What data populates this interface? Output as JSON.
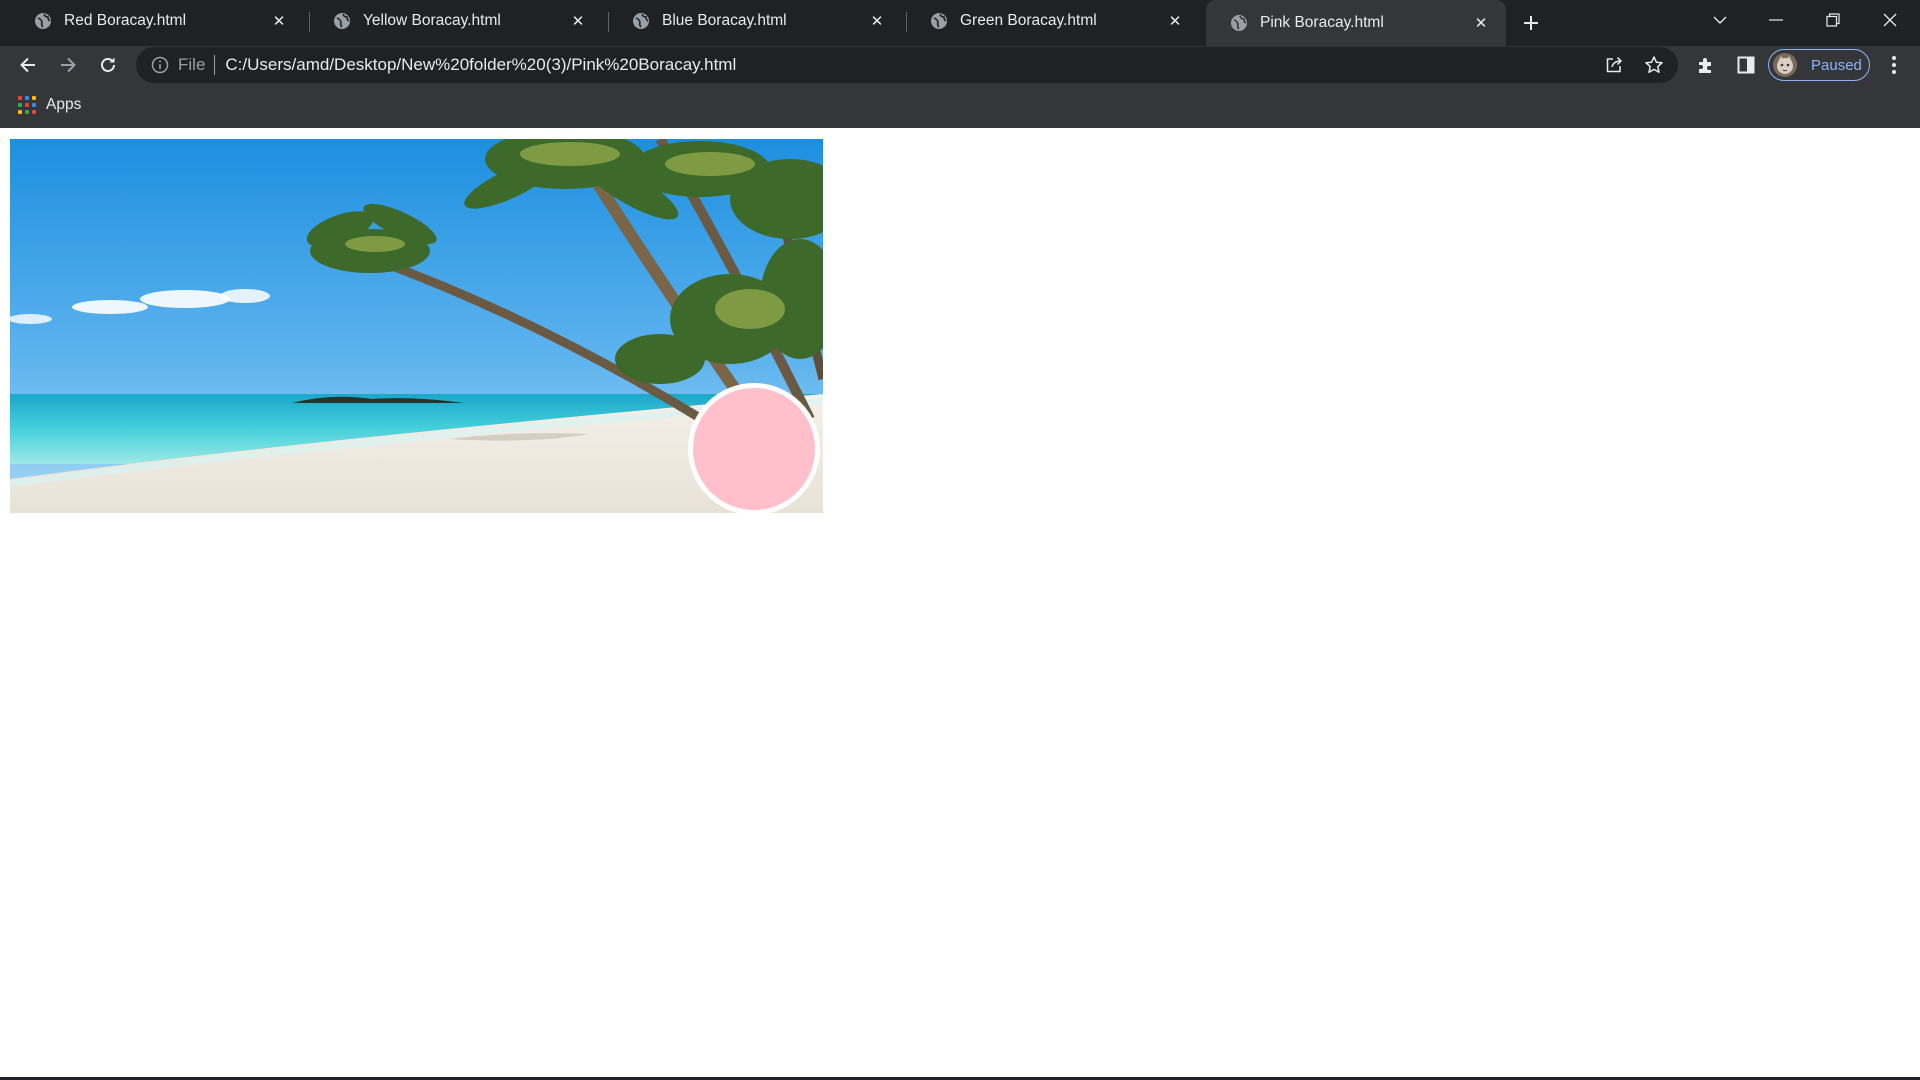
{
  "browser": {
    "tabs": [
      {
        "title": "Red Boracay.html",
        "active": false
      },
      {
        "title": "Yellow Boracay.html",
        "active": false
      },
      {
        "title": "Blue Boracay.html",
        "active": false
      },
      {
        "title": "Green Boracay.html",
        "active": false
      },
      {
        "title": "Pink Boracay.html",
        "active": true
      }
    ],
    "address_bar": {
      "scheme_label": "File",
      "url": "C:/Users/amd/Desktop/New%20folder%20(3)/Pink%20Boracay.html"
    },
    "profile": {
      "status_label": "Paused"
    },
    "bookmarks": [
      {
        "label": "Apps"
      }
    ]
  },
  "page": {
    "banner_image": "boracay-beach-palm-trees",
    "circle_color": "#ffc0cb"
  },
  "colors": {
    "titlebar": "#202124",
    "toolbar": "#35363a",
    "accent": "#8ab4f8"
  },
  "icons": [
    "globe-icon",
    "close-icon",
    "plus-icon",
    "chevron-down-icon",
    "minimize-icon",
    "restore-icon",
    "window-close-icon",
    "back-arrow-icon",
    "forward-arrow-icon",
    "reload-icon",
    "info-icon",
    "share-icon",
    "star-icon",
    "puzzle-icon",
    "side-panel-icon",
    "kebab-menu-icon",
    "apps-grid-icon"
  ]
}
